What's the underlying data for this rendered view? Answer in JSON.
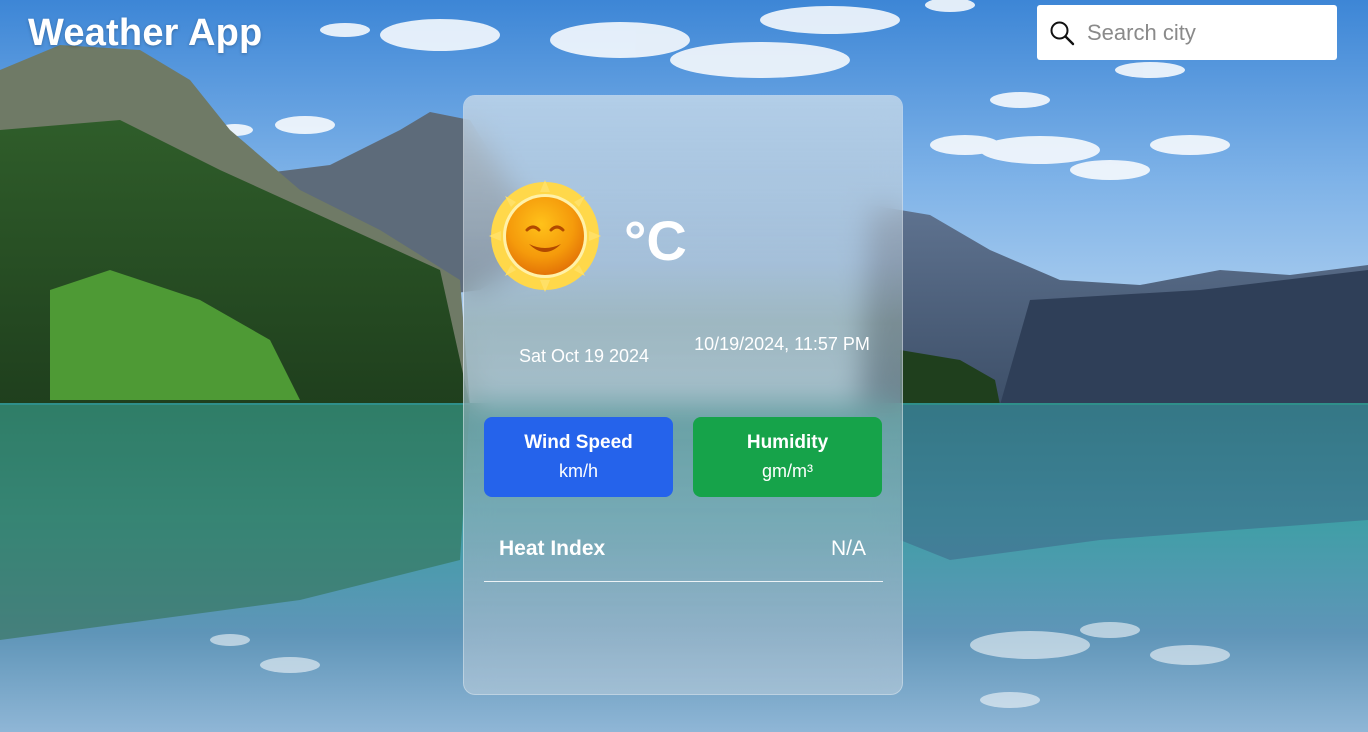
{
  "header": {
    "title": "Weather App"
  },
  "search": {
    "placeholder": "Search city",
    "icon": "search-icon"
  },
  "weather": {
    "icon": "smiling-sun-icon",
    "temperature_unit": "°C",
    "date": "Sat Oct 19 2024",
    "datetime": "10/19/2024, 11:57 PM",
    "wind": {
      "label": "Wind Speed",
      "unit": "km/h"
    },
    "humidity": {
      "label": "Humidity",
      "unit": "gm/m³"
    },
    "heat_index": {
      "label": "Heat Index",
      "value": "N/A"
    }
  },
  "colors": {
    "wind_box": "#2563eb",
    "humidity_box": "#16a34a",
    "text": "#ffffff"
  }
}
